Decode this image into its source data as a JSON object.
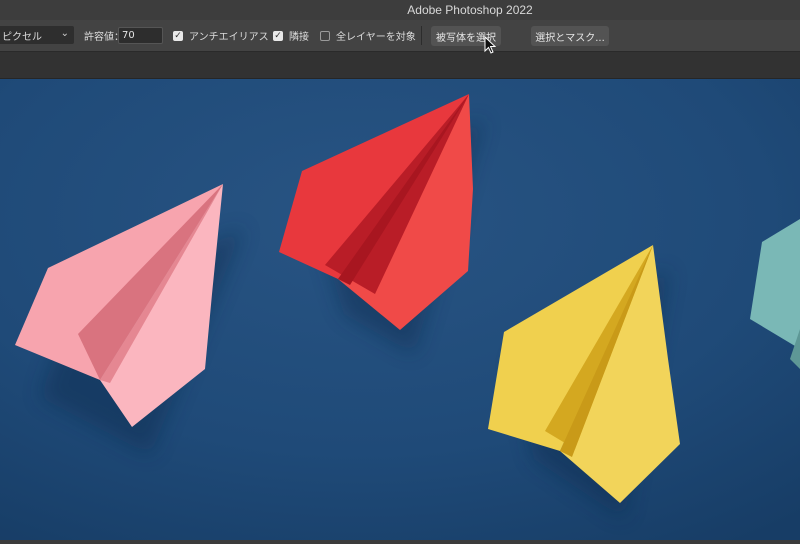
{
  "app": {
    "title": "Adobe Photoshop 2022"
  },
  "options_bar": {
    "sample_size": "ピクセル",
    "tolerance_label": "許容値：",
    "tolerance_value": "70",
    "anti_alias": {
      "label": "アンチエイリアス",
      "checked": true
    },
    "contiguous": {
      "label": "隣接",
      "checked": true
    },
    "sample_all_layers": {
      "label": "全レイヤーを対象",
      "checked": false
    },
    "select_subject_label": "被写体を選択",
    "select_and_mask_label": "選択とマスク..."
  },
  "canvas": {
    "background_color": "#1f4a78",
    "planes": [
      {
        "name": "pink-paper-plane",
        "color": "#f7a4ae"
      },
      {
        "name": "red-paper-plane",
        "color": "#e8383d"
      },
      {
        "name": "yellow-paper-plane",
        "color": "#f0d04e"
      },
      {
        "name": "teal-paper-plane",
        "color": "#7ab8b6"
      }
    ]
  }
}
